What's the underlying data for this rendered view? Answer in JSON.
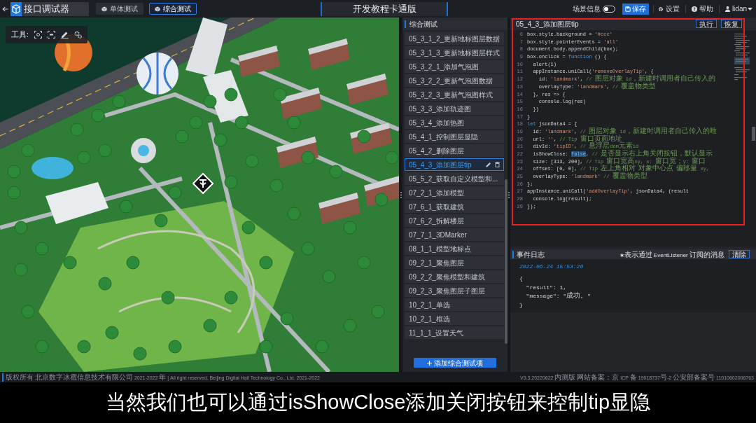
{
  "top_bar": {
    "app_title": "接口调试器",
    "tabs": [
      {
        "label": "单体测试",
        "selected": false
      },
      {
        "label": "综合测试",
        "selected": true
      }
    ],
    "project_title": "开发教程卡通版",
    "scene_info": {
      "label": "场景信息",
      "on": false
    },
    "actions": [
      {
        "label": "保存",
        "kind": "save"
      },
      {
        "label": "设置",
        "kind": "settings"
      },
      {
        "label": "帮助",
        "kind": "help"
      }
    ],
    "user": "lidan"
  },
  "scene": {
    "toolbar_label": "工具:"
  },
  "test_panel": {
    "title": "综合测试",
    "items": [
      {
        "label": "05_3_1_2_更新地标图层数据",
        "selected": false
      },
      {
        "label": "05_3_1_3_更新地标图层样式",
        "selected": false
      },
      {
        "label": "05_3_2_1_添加气泡图",
        "selected": false
      },
      {
        "label": "05_3_2_2_更新气泡图数据",
        "selected": false
      },
      {
        "label": "05_3_2_3_更新气泡图样式",
        "selected": false
      },
      {
        "label": "05_3_3_添加轨迹图",
        "selected": false
      },
      {
        "label": "05_3_4_添加热图",
        "selected": false
      },
      {
        "label": "05_4_1_控制图层显隐",
        "selected": false
      },
      {
        "label": "05_4_2_删除图层",
        "selected": false
      },
      {
        "label": "05_4_3_添加图层tip",
        "selected": true
      },
      {
        "label": "05_5_2_获取自定义模型和...",
        "selected": false
      },
      {
        "label": "07_2_1_添加模型",
        "selected": false
      },
      {
        "label": "07_6_1_获取建筑",
        "selected": false
      },
      {
        "label": "07_6_2_拆解楼层",
        "selected": false
      },
      {
        "label": "07_7_1_3DMarker",
        "selected": false
      },
      {
        "label": "08_1_1_模型地标点",
        "selected": false
      },
      {
        "label": "09_2_1_聚焦图层",
        "selected": false
      },
      {
        "label": "09_2_2_聚焦模型和建筑",
        "selected": false
      },
      {
        "label": "09_2_3_聚焦图层子图层",
        "selected": false
      },
      {
        "label": "10_2_1_单选",
        "selected": false
      },
      {
        "label": "10_2_1_框选",
        "selected": false
      },
      {
        "label": "11_1_1_设置天气",
        "selected": false
      }
    ],
    "add_button": "添加综合测试项"
  },
  "editor": {
    "title": "05_4_3_添加图层tip",
    "buttons": [
      "执行",
      "恢复"
    ],
    "lines": [
      {
        "number": "6",
        "tokens": [
          {
            "text": "box.style.background = ",
            "kind": "plain"
          },
          {
            "text": "'#ccc'",
            "kind": "string"
          }
        ]
      },
      {
        "number": "7",
        "tokens": [
          {
            "text": "box.style.pointerEvents = ",
            "kind": "plain"
          },
          {
            "text": "'all'",
            "kind": "string"
          }
        ]
      },
      {
        "number": "8",
        "tokens": [
          {
            "text": "document.body.appendChild(box);",
            "kind": "plain"
          }
        ]
      },
      {
        "number": "9",
        "tokens": [
          {
            "text": "box.onclick = ",
            "kind": "plain"
          },
          {
            "text": "function",
            "kind": "keyword"
          },
          {
            "text": " () {",
            "kind": "plain"
          }
        ]
      },
      {
        "number": "10",
        "tokens": [
          {
            "text": "  alert(1)",
            "kind": "plain"
          }
        ]
      },
      {
        "number": "11",
        "tokens": [
          {
            "text": "  appInstance.uniCall(",
            "kind": "plain"
          },
          {
            "text": "'removeOverlayTip'",
            "kind": "string"
          },
          {
            "text": ", {",
            "kind": "plain"
          }
        ]
      },
      {
        "number": "12",
        "tokens": [
          {
            "text": "    id: ",
            "kind": "plain"
          },
          {
            "text": "'landmark'",
            "kind": "string"
          },
          {
            "text": ", ",
            "kind": "plain"
          },
          {
            "text": "// 图层对象 id，新建时调用者自己传入的",
            "kind": "comment"
          }
        ]
      },
      {
        "number": "13",
        "tokens": [
          {
            "text": "    overlayType: ",
            "kind": "plain"
          },
          {
            "text": "'landmark'",
            "kind": "string"
          },
          {
            "text": ", ",
            "kind": "plain"
          },
          {
            "text": "// 覆盖物类型",
            "kind": "comment"
          }
        ]
      },
      {
        "number": "14",
        "tokens": [
          {
            "text": "  }, res => {",
            "kind": "plain"
          }
        ]
      },
      {
        "number": "15",
        "tokens": [
          {
            "text": "    console.log(res)",
            "kind": "plain"
          }
        ]
      },
      {
        "number": "16",
        "tokens": [
          {
            "text": "  })",
            "kind": "plain"
          }
        ]
      },
      {
        "number": "17",
        "tokens": [
          {
            "text": "}",
            "kind": "plain"
          }
        ]
      },
      {
        "number": "18",
        "tokens": [
          {
            "text": "let",
            "kind": "keyword"
          },
          {
            "text": " jsonData4 = {",
            "kind": "plain"
          }
        ]
      },
      {
        "number": "19",
        "tokens": [
          {
            "text": "  id: ",
            "kind": "plain"
          },
          {
            "text": "'landmark'",
            "kind": "string"
          },
          {
            "text": ", ",
            "kind": "plain"
          },
          {
            "text": "// 图层对象 id，新建时调用者自己传入的唯",
            "kind": "comment"
          }
        ]
      },
      {
        "number": "20",
        "tokens": [
          {
            "text": "  url: ",
            "kind": "plain"
          },
          {
            "text": "''",
            "kind": "string"
          },
          {
            "text": ", ",
            "kind": "plain"
          },
          {
            "text": "// Tip 窗口页面地址",
            "kind": "comment"
          }
        ]
      },
      {
        "number": "21",
        "tokens": [
          {
            "text": "  divId: ",
            "kind": "plain"
          },
          {
            "text": "'tipID'",
            "kind": "string"
          },
          {
            "text": ", ",
            "kind": "plain"
          },
          {
            "text": "// 悬浮层dom元素id",
            "kind": "comment"
          }
        ]
      },
      {
        "number": "22",
        "tokens": [
          {
            "text": "  isShowClose: ",
            "kind": "plain"
          },
          {
            "text": "false",
            "kind": "selection"
          },
          {
            "text": ", ",
            "kind": "plain"
          },
          {
            "text": "// 是否显示右上角关闭按钮，默认显示",
            "kind": "comment"
          }
        ]
      },
      {
        "number": "23",
        "tokens": [
          {
            "text": "  size: [313, 200], ",
            "kind": "plain"
          },
          {
            "text": "// Tip 窗口宽高xy, x: 窗口宽；y: 窗口",
            "kind": "comment"
          }
        ]
      },
      {
        "number": "24",
        "tokens": [
          {
            "text": "  offset: [0, 0], ",
            "kind": "plain"
          },
          {
            "text": "// Tip 左上角相对 对象中心点 偏移量 xy,",
            "kind": "comment"
          }
        ]
      },
      {
        "number": "25",
        "tokens": [
          {
            "text": "  overlayType: ",
            "kind": "plain"
          },
          {
            "text": "'landmark'",
            "kind": "string"
          },
          {
            "text": " // 覆盖物类型",
            "kind": "comment"
          }
        ]
      },
      {
        "number": "26",
        "tokens": [
          {
            "text": "};",
            "kind": "plain"
          }
        ]
      },
      {
        "number": "27",
        "tokens": [
          {
            "text": "appInstance.uniCall(",
            "kind": "plain"
          },
          {
            "text": "'addOverlayTip'",
            "kind": "string"
          },
          {
            "text": ", jsonData4, (result",
            "kind": "plain"
          }
        ]
      },
      {
        "number": "28",
        "tokens": [
          {
            "text": "  console.log(result);",
            "kind": "plain"
          }
        ]
      },
      {
        "number": "29",
        "tokens": [
          {
            "text": "});",
            "kind": "plain"
          }
        ]
      }
    ]
  },
  "event_log": {
    "title": "事件日志",
    "hint": "★表示通过 EventListener 订阅的消息",
    "clear_button": "清除",
    "entries": [
      {
        "time": "2022-06-24 15:53:20",
        "lines": [
          "{",
          "  \"result\": 1,",
          "  \"message\": \"成功。\"",
          "}"
        ]
      }
    ]
  },
  "footer": {
    "copyright": "版权所有 北京数字冰雹信息技术有限公司 2021-2022 年 | All right reserved. Beijing Digital Hail Technology Co., Ltd. 2021-2022",
    "version": "V3.3.20220622 内测版 网站备案：京 ICP 备 19018737号-2 公安部备案号 11010602006763"
  },
  "subtitle": "当然我们也可以通过isShowClose添加关闭按钮来控制tip显隐"
}
